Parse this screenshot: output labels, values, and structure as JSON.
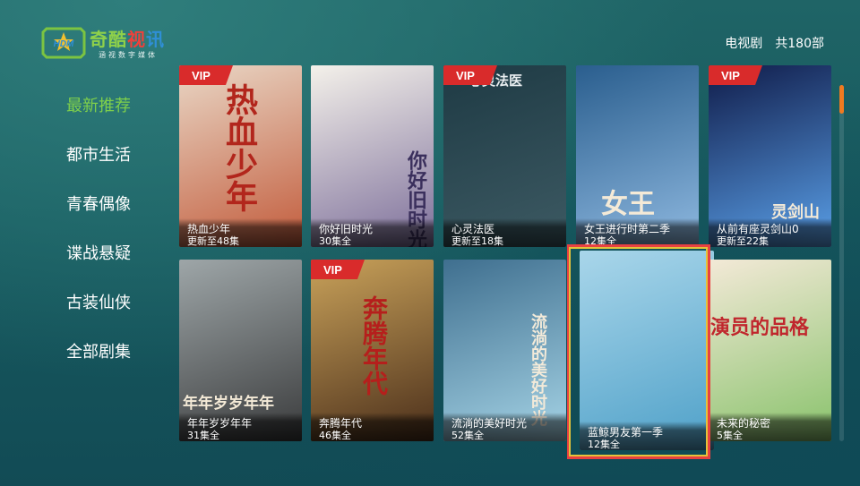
{
  "app": {
    "logo_title_part1": "奇酷",
    "logo_title_part2": "视",
    "logo_title_part3": "讯",
    "logo_subtitle": "涵视数字媒体",
    "logo_badge_text": "HDM"
  },
  "header": {
    "category": "电视剧",
    "total": "共180部"
  },
  "nav": {
    "items": [
      {
        "label": "最新推荐",
        "active": true
      },
      {
        "label": "都市生活",
        "active": false
      },
      {
        "label": "青春偶像",
        "active": false
      },
      {
        "label": "谍战悬疑",
        "active": false
      },
      {
        "label": "古装仙侠",
        "active": false
      },
      {
        "label": "全部剧集",
        "active": false
      }
    ]
  },
  "vip_label": "VIP",
  "posters": [
    {
      "title": "热血少年",
      "sub": "更新至48集",
      "vip": true,
      "art": "热血少年",
      "colors": [
        "#e9d7c6",
        "#c25b3b"
      ]
    },
    {
      "title": "你好旧时光",
      "sub": "30集全",
      "vip": false,
      "art": "你好旧时光",
      "colors": [
        "#f4f1ea",
        "#7c6e9a"
      ]
    },
    {
      "title": "心灵法医",
      "sub": "更新至18集",
      "vip": true,
      "art": "心灵法医",
      "colors": [
        "#1e3a44",
        "#3d5a63"
      ]
    },
    {
      "title": "女王进行时第二季",
      "sub": "12集全",
      "vip": false,
      "art": "女王",
      "colors": [
        "#2a5e8e",
        "#8fb9e0"
      ]
    },
    {
      "title": "从前有座灵剑山0",
      "sub": "更新至22集",
      "vip": true,
      "art": "灵剑山",
      "colors": [
        "#101c4a",
        "#5aa0e8"
      ]
    },
    {
      "title": "年年岁岁年年",
      "sub": "31集全",
      "vip": false,
      "art": "年年岁岁年年",
      "colors": [
        "#9ea6a8",
        "#3a3b3c"
      ]
    },
    {
      "title": "奔腾年代",
      "sub": "46集全",
      "vip": true,
      "art": "奔腾年代",
      "colors": [
        "#c9a25a",
        "#4a2e1a"
      ]
    },
    {
      "title": "流淌的美好时光",
      "sub": "52集全",
      "vip": false,
      "art": "流淌的美好时光",
      "colors": [
        "#3f6f8f",
        "#a6d4e6"
      ]
    },
    {
      "title": "蓝鲸男友第一季",
      "sub": "12集全",
      "vip": false,
      "art": "",
      "colors": [
        "#a9d6ea",
        "#4ea0c8"
      ]
    },
    {
      "title": "未来的秘密",
      "sub": "5集全",
      "vip": false,
      "art": "演员的品格",
      "colors": [
        "#f3e9d7",
        "#88c26b"
      ]
    }
  ],
  "focus_index": 8,
  "scroll_progress": 0.0
}
